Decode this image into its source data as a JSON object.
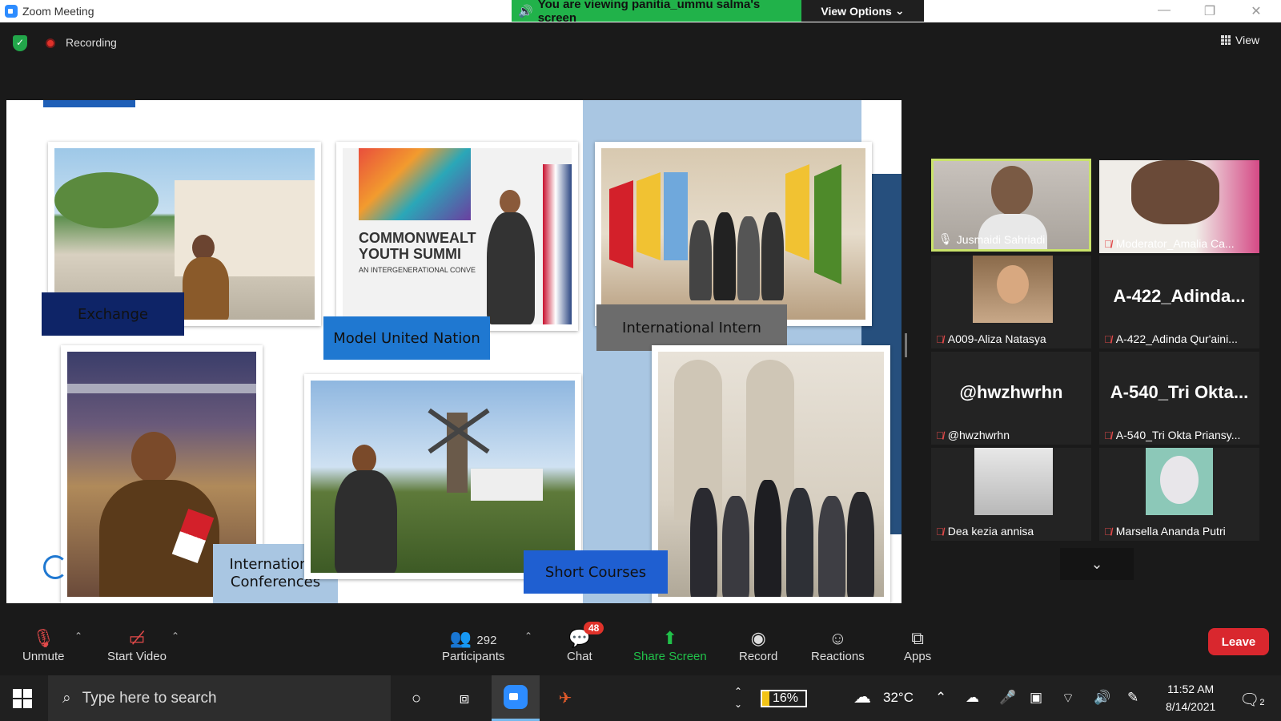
{
  "window": {
    "title": "Zoom Meeting"
  },
  "banner": {
    "text": "You are viewing panitia_ummu salma's screen",
    "view_options": "View Options"
  },
  "top": {
    "recording": "Recording",
    "view": "View"
  },
  "slide": {
    "labels": {
      "exchange": "Exchange",
      "mun": "Model United Nation",
      "intern": "International Intern",
      "conferences_line1": "International",
      "conferences_line2": "Conferences",
      "short_courses": "Short Courses"
    },
    "poster_text": {
      "line1": "COMMONWEALT",
      "line2": "YOUTH SUMMI",
      "line3": "AN INTERGENERATIONAL CONVE"
    }
  },
  "participants": [
    {
      "name": "Jusmaidi Sahriadi",
      "active": true,
      "muted": false
    },
    {
      "name": "Moderator_Amalia Ca...",
      "muted": true
    },
    {
      "name": "A009-Aliza Natasya",
      "muted": true
    },
    {
      "name": "A-422_Adinda Qur'aini...",
      "display": "A-422_Adinda...",
      "muted": true
    },
    {
      "name": "@hwzhwrhn",
      "display": "@hwzhwrhn",
      "muted": true
    },
    {
      "name": "A-540_Tri Okta Priansy...",
      "display": "A-540_Tri  Okta...",
      "muted": true
    },
    {
      "name": "Dea kezia annisa",
      "muted": true
    },
    {
      "name": "Marsella Ananda Putri",
      "muted": true
    }
  ],
  "toolbar": {
    "unmute": "Unmute",
    "start_video": "Start Video",
    "participants_label": "Participants",
    "participants_count": "292",
    "chat": "Chat",
    "chat_badge": "48",
    "share_screen": "Share Screen",
    "record": "Record",
    "reactions": "Reactions",
    "apps": "Apps",
    "leave": "Leave"
  },
  "taskbar": {
    "search_placeholder": "Type here to search",
    "battery": "16%",
    "weather": "32°C",
    "time": "11:52 AM",
    "date": "8/14/2021",
    "notifications": "2"
  },
  "colors": {
    "banner_green": "#21b24a",
    "leave_red": "#d9272e",
    "active_speaker": "#c9e26a"
  }
}
